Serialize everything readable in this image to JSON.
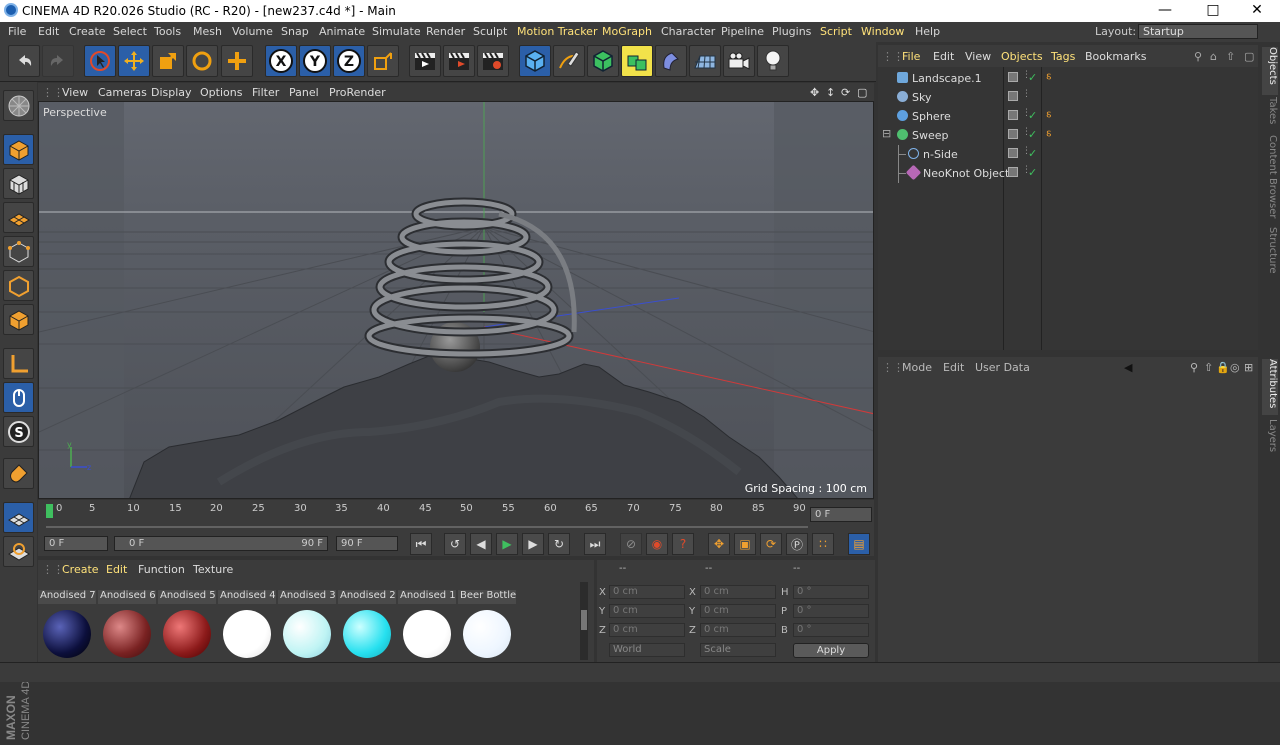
{
  "window": {
    "title": "CINEMA 4D R20.026 Studio (RC - R20) - [new237.c4d *] - Main"
  },
  "menubar": {
    "items": [
      "File",
      "Edit",
      "Create",
      "Select",
      "Tools",
      "Mesh",
      "Volume",
      "Snap",
      "Animate",
      "Simulate",
      "Render",
      "Sculpt",
      "Motion Tracker",
      "MoGraph",
      "Character",
      "Pipeline",
      "Plugins",
      "Script",
      "Window",
      "Help"
    ],
    "layout_label": "Layout:",
    "layout_value": "Startup"
  },
  "viewport": {
    "menu": [
      "View",
      "Cameras",
      "Display",
      "Options",
      "Filter",
      "Panel",
      "ProRender"
    ],
    "camera_label": "Perspective",
    "grid_spacing": "Grid Spacing : 100 cm"
  },
  "timeline": {
    "ticks": [
      "0",
      "5",
      "10",
      "15",
      "20",
      "25",
      "30",
      "35",
      "40",
      "45",
      "50",
      "55",
      "60",
      "65",
      "70",
      "75",
      "80",
      "85",
      "90"
    ],
    "current_frame": "0 F"
  },
  "transport": {
    "start": "0 F",
    "range_start": "0 F",
    "range_end": "90 F",
    "end": "90 F"
  },
  "materials": {
    "menu": [
      "Create",
      "Edit",
      "Function",
      "Texture"
    ],
    "items": [
      {
        "name": "Anodised 7",
        "color": "#1a1f6e"
      },
      {
        "name": "Anodised 6",
        "color": "#8a2a2a"
      },
      {
        "name": "Anodised 5",
        "color": "#8c1a1a"
      },
      {
        "name": "Anodised 4",
        "color": "#ffffff"
      },
      {
        "name": "Anodised 3",
        "color": "#bff4f4"
      },
      {
        "name": "Anodised 2",
        "color": "#26e0ef"
      },
      {
        "name": "Anodised 1",
        "color": "#ffffff"
      },
      {
        "name": "Beer Bottle",
        "color": "#eef6ff"
      }
    ]
  },
  "coordinates": {
    "headers": [
      "--",
      "--",
      "--"
    ],
    "rows": [
      {
        "axis1": "X",
        "v1": "0 cm",
        "axis2": "X",
        "v2": "0 cm",
        "axis3": "H",
        "v3": "0 °"
      },
      {
        "axis1": "Y",
        "v1": "0 cm",
        "axis2": "Y",
        "v2": "0 cm",
        "axis3": "P",
        "v3": "0 °"
      },
      {
        "axis1": "Z",
        "v1": "0 cm",
        "axis2": "Z",
        "v2": "0 cm",
        "axis3": "B",
        "v3": "0 °"
      }
    ],
    "mode_select": "World",
    "scale_select": "Scale",
    "apply_label": "Apply"
  },
  "object_manager": {
    "menu": [
      "File",
      "Edit",
      "View",
      "Objects",
      "Tags",
      "Bookmarks"
    ],
    "objects": [
      {
        "name": "Landscape.1",
        "icon_color": "#6fa8dc"
      },
      {
        "name": "Sky",
        "icon_color": "#8aaed6"
      },
      {
        "name": "Sphere",
        "icon_color": "#5ea0e0"
      },
      {
        "name": "Sweep",
        "icon_color": "#4fbf6f"
      },
      {
        "name": "n-Side",
        "icon_color": "#7fb2e8"
      },
      {
        "name": "NeoKnot Object",
        "icon_color": "#b768b6"
      }
    ]
  },
  "attributes": {
    "menu": [
      "Mode",
      "Edit",
      "User Data"
    ]
  },
  "right_tabs": [
    "Objects",
    "Takes",
    "Content Browser",
    "Structure",
    "Attributes",
    "Layers"
  ],
  "brand": {
    "line1": "MAXON",
    "line2": "CINEMA 4D"
  },
  "colors": {
    "accent_active": "#2b5fa8",
    "highlight_menu": "#ffe27a"
  }
}
